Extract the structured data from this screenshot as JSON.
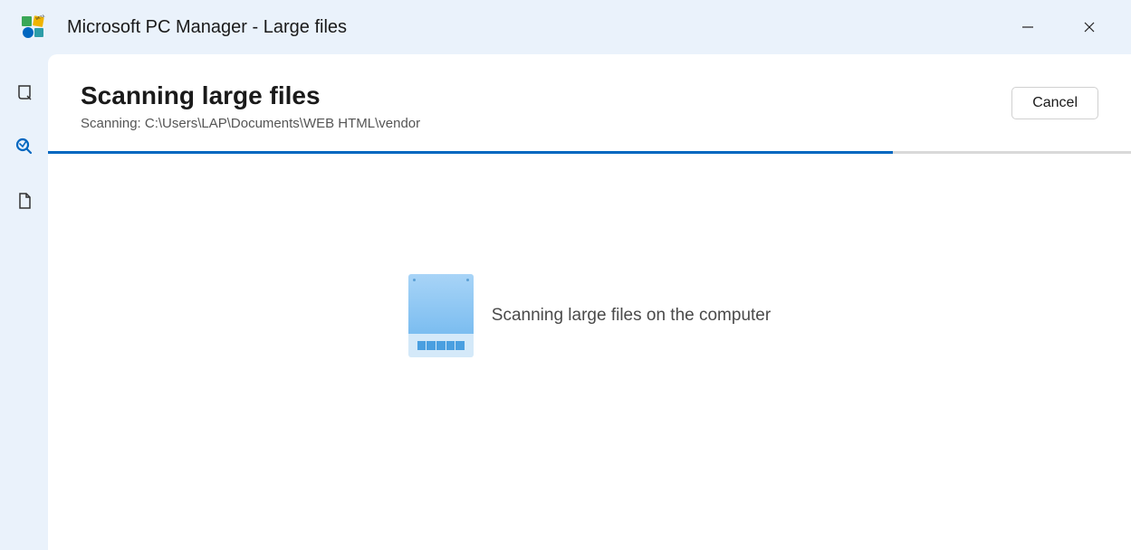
{
  "window": {
    "title": "Microsoft PC Manager - Large files"
  },
  "header": {
    "title": "Scanning large files",
    "scan_prefix": "Scanning: ",
    "scan_path": "C:\\Users\\LAP\\Documents\\WEB HTML\\vendor",
    "cancel_label": "Cancel"
  },
  "progress": {
    "percent": 78
  },
  "center": {
    "message": "Scanning large files on the computer"
  },
  "sidebar": {
    "items": [
      {
        "name": "cleanup",
        "icon": "cleanup-icon",
        "active": false
      },
      {
        "name": "scan",
        "icon": "scan-icon",
        "active": true
      },
      {
        "name": "files",
        "icon": "files-icon",
        "active": false
      }
    ]
  }
}
